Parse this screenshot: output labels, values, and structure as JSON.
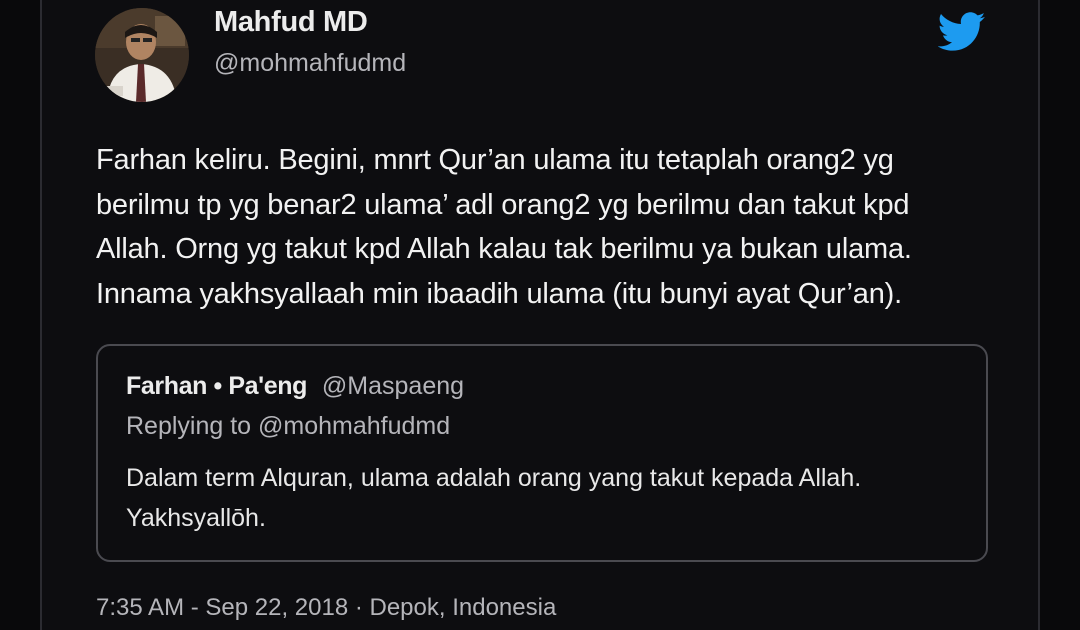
{
  "tweet": {
    "author_name": "Mahfud MD",
    "author_handle": "@mohmahfudmd",
    "avatar_icon": "profile-photo",
    "brand_icon": "twitter-bird-icon",
    "brand_color": "#1d9bf0",
    "text_lines": [
      "Farhan keliru. Begini, mnrt Qur’an ulama itu tetaplah orang2 yg",
      "berilmu tp yg benar2 ulama’ adl orang2 yg berilmu dan takut kpd",
      "Allah. Orng yg takut kpd Allah kalau tak berilmu ya bukan ulama.",
      "Innama yakhsyallaah min ibaadih ulama (itu bunyi ayat Qur’an)."
    ],
    "timestamp": "7:35 AM - Sep 22, 2018 · Depok, Indonesia"
  },
  "quoted_tweet": {
    "author_name": "Farhan • Pa'eng",
    "author_handle": "@Maspaeng",
    "replying_to": "Replying to @mohmahfudmd",
    "text_lines": [
      "Dalam term Alquran, ulama adalah orang yang takut kepada Allah.",
      "Yakhsyallōh."
    ]
  }
}
